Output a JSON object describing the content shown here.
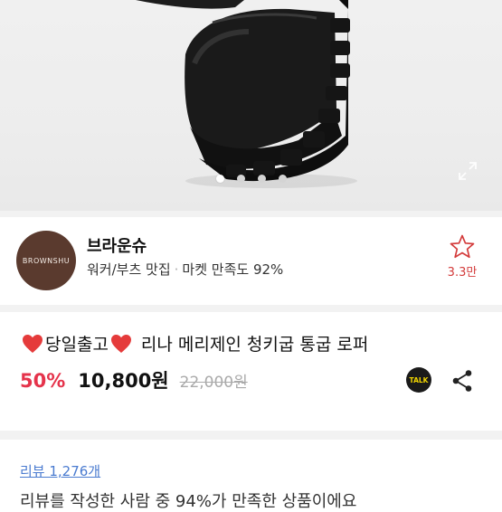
{
  "hero": {
    "image_icon": "black-platform-loafer-photo",
    "slide_dots": 4,
    "active_dot": 0,
    "expand_icon": "expand-icon"
  },
  "seller": {
    "avatar_text": "BROWNSHU",
    "name": "브라운슈",
    "tag": "워커/부츠 맛집",
    "separator": "·",
    "rating": "마켓 만족도 92%",
    "favorite_icon": "star-outline-icon",
    "favorite_count": "3.3만"
  },
  "product": {
    "title": "당일출고",
    "title_rest": "리나 메리제인 청키굽 통굽 로퍼",
    "heart_icon": "heart-icon",
    "discount": "50%",
    "price": "10,800원",
    "original_price": "22,000원",
    "talk_icon_text": "TALK",
    "share_icon": "share-icon"
  },
  "review": {
    "link": "리뷰 1,276개",
    "summary": "리뷰를 작성한 사람 중 94%가 만족한 상품이에요"
  },
  "colors": {
    "discount": "#e5334b",
    "avatar_bg": "#5a3a2e",
    "link": "#4a7bd0",
    "talk_bg": "#1a1a1a"
  }
}
